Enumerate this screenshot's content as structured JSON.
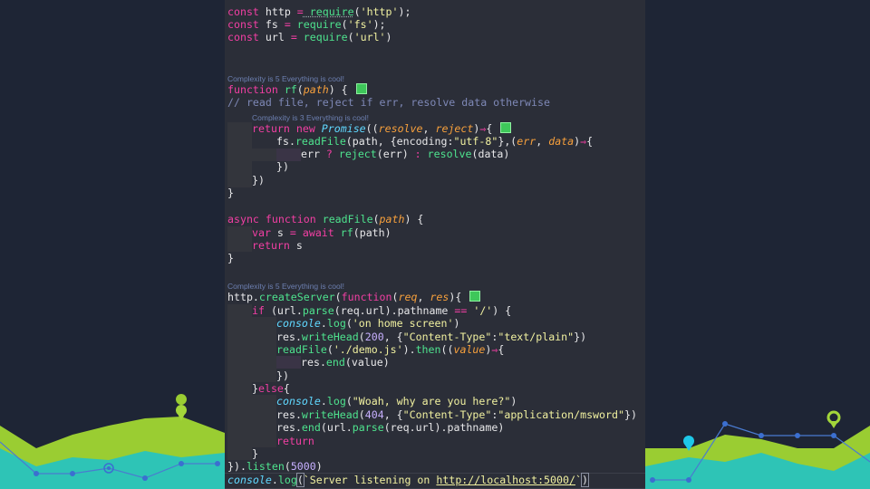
{
  "editor": {
    "lines": {
      "l1": {
        "kw": "const",
        "name": " http ",
        "op": "=",
        "call": " require",
        "open": "(",
        "str": "'http'",
        "close": ");"
      },
      "l2": {
        "kw": "const",
        "name": " fs ",
        "op": "=",
        "call": " require",
        "open": "(",
        "str": "'fs'",
        "close": ");"
      },
      "l3": {
        "kw": "const",
        "name": " url ",
        "op": "=",
        "call": " require",
        "open": "(",
        "str": "'url'",
        "close": ")"
      },
      "lens1": "Complexity is 5 Everything is cool!",
      "l4": {
        "kw": "function",
        "fn": " rf",
        "open": "(",
        "param": "path",
        "close": ") {"
      },
      "l5": "// read file, reject if err, resolve data otherwise",
      "lens2": "Complexity is 3 Everything is cool!",
      "l6": {
        "kw1": "return",
        "kw2": " new",
        "cls": " Promise",
        "open": "((",
        "p1": "resolve",
        "sep": ", ",
        "p2": "reject",
        "close": ")",
        "arrow": "⇒",
        "brace": "{"
      },
      "l7": {
        "obj": "fs.",
        "fn": "readFile",
        "a": "(path, {encoding:",
        "str": "\"utf-8\"",
        "b": "},(",
        "p1": "err",
        "sep": ", ",
        "p2": "data",
        "c": ")",
        "arrow": "⇒",
        "brace": "{"
      },
      "l8": {
        "a": "err ",
        "op": "?",
        "fn1": " reject",
        "b": "(err) ",
        "op2": ":",
        "fn2": " resolve",
        "c": "(data)"
      },
      "l9": "})",
      "l10": "})",
      "l11": "}",
      "l12": {
        "kw1": "async",
        "kw2": " function",
        "fn": " readFile",
        "open": "(",
        "param": "path",
        "close": ") {"
      },
      "l13": {
        "kw": "var",
        "a": " s ",
        "op": "=",
        "kw2": " await",
        "fn": " rf",
        "b": "(path)"
      },
      "l14": {
        "kw": "return",
        "a": " s"
      },
      "l15": "}",
      "lens3": "Complexity is 5 Everything is cool!",
      "l16": {
        "a": "http.",
        "fn": "createServer",
        "b": "(",
        "kw": "function",
        "c": "(",
        "p1": "req",
        "sep": ", ",
        "p2": "res",
        "d": "){"
      },
      "l17": {
        "kw": "if",
        "a": " (url.",
        "fn": "parse",
        "b": "(req.url).pathname ",
        "op": "==",
        "c": " ",
        "str": "'/'",
        "d": ") {"
      },
      "l18": {
        "cls": "console",
        "a": ".",
        "fn": "log",
        "b": "(",
        "str": "'on home screen'",
        "c": ")"
      },
      "l19": {
        "a": "res.",
        "fn": "writeHead",
        "b": "(",
        "num": "200",
        "c": ", {",
        "s1": "\"Content-Type\"",
        "d": ":",
        "s2": "\"text/plain\"",
        "e": "})"
      },
      "l20": {
        "fn": "readFile",
        "a": "(",
        "str": "'./demo.js'",
        "b": ").",
        "fn2": "then",
        "c": "((",
        "param": "value",
        "d": ")",
        "arrow": "⇒",
        "e": "{"
      },
      "l21": {
        "a": "res.",
        "fn": "end",
        "b": "(value)"
      },
      "l22": "})",
      "l23": {
        "a": "}",
        "kw": "else",
        "b": "{"
      },
      "l24": {
        "cls": "console",
        "a": ".",
        "fn": "log",
        "b": "(",
        "str": "\"Woah, why are you here?\"",
        "c": ")"
      },
      "l25": {
        "a": "res.",
        "fn": "writeHead",
        "b": "(",
        "num": "404",
        "c": ", {",
        "s1": "\"Content-Type\"",
        "d": ":",
        "s2": "\"application/msword\"",
        "e": "})"
      },
      "l26": {
        "a": "res.",
        "fn": "end",
        "b": "(url.",
        "fn2": "parse",
        "c": "(req.url).pathname)"
      },
      "l27": {
        "kw": "return"
      },
      "l28": "}",
      "l29": {
        "a": "}).",
        "fn": "listen",
        "b": "(",
        "num": "5000",
        "c": ")"
      },
      "l30": {
        "cls": "console",
        "a": ".",
        "fn": "log",
        "b": "(",
        "s1": "`Server listening on ",
        "link": "http://localhost:5000/",
        "s2": "`",
        "c": ")"
      }
    }
  }
}
